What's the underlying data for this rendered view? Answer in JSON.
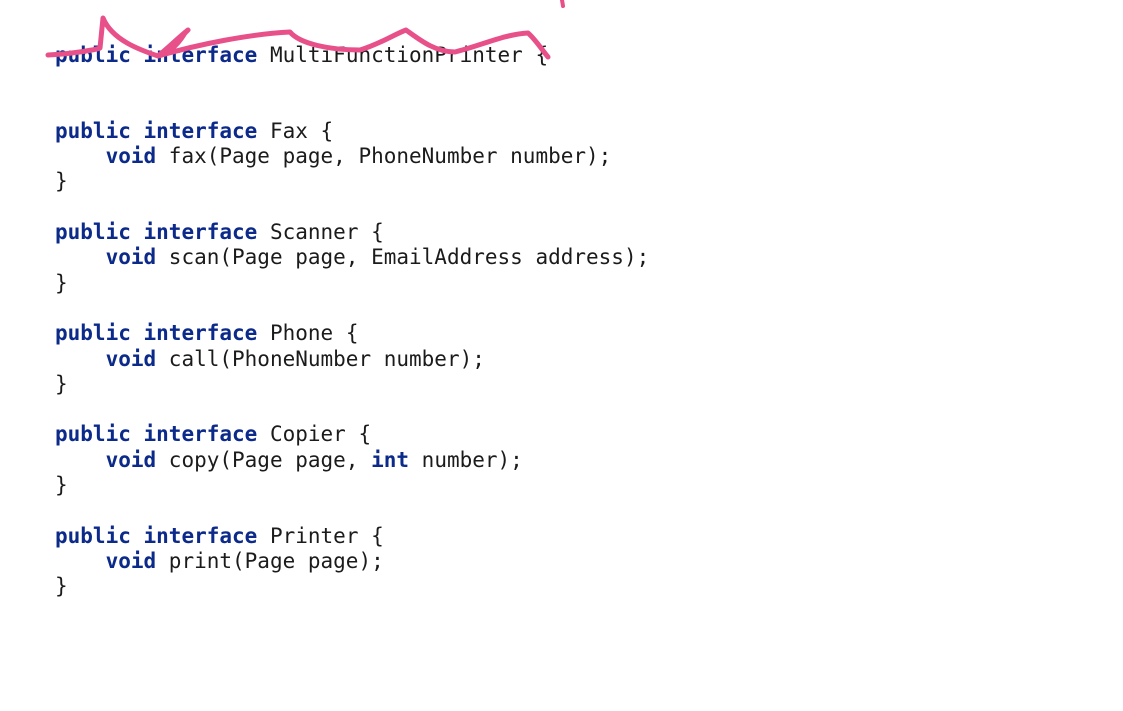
{
  "theme": {
    "keyword_color": "#0b2a8a",
    "text_color": "#1b1b1b",
    "annotation_color": "#e8508a"
  },
  "code": {
    "lines": [
      [
        {
          "k": true,
          "t": "public"
        },
        {
          "t": " "
        },
        {
          "k": true,
          "t": "interface"
        },
        {
          "t": " MultiFunctionPrinter {"
        }
      ],
      [],
      [],
      [
        {
          "k": true,
          "t": "public"
        },
        {
          "t": " "
        },
        {
          "k": true,
          "t": "interface"
        },
        {
          "t": " Fax {"
        }
      ],
      [
        {
          "t": "    "
        },
        {
          "k": true,
          "t": "void"
        },
        {
          "t": " fax(Page page, PhoneNumber number);"
        }
      ],
      [
        {
          "t": "}"
        }
      ],
      [],
      [
        {
          "k": true,
          "t": "public"
        },
        {
          "t": " "
        },
        {
          "k": true,
          "t": "interface"
        },
        {
          "t": " Scanner {"
        }
      ],
      [
        {
          "t": "    "
        },
        {
          "k": true,
          "t": "void"
        },
        {
          "t": " scan(Page page, EmailAddress address);"
        }
      ],
      [
        {
          "t": "}"
        }
      ],
      [],
      [
        {
          "k": true,
          "t": "public"
        },
        {
          "t": " "
        },
        {
          "k": true,
          "t": "interface"
        },
        {
          "t": " Phone {"
        }
      ],
      [
        {
          "t": "    "
        },
        {
          "k": true,
          "t": "void"
        },
        {
          "t": " call(PhoneNumber number);"
        }
      ],
      [
        {
          "t": "}"
        }
      ],
      [],
      [
        {
          "k": true,
          "t": "public"
        },
        {
          "t": " "
        },
        {
          "k": true,
          "t": "interface"
        },
        {
          "t": " Copier {"
        }
      ],
      [
        {
          "t": "    "
        },
        {
          "k": true,
          "t": "void"
        },
        {
          "t": " copy(Page page, "
        },
        {
          "k": true,
          "t": "int"
        },
        {
          "t": " number);"
        }
      ],
      [
        {
          "t": "}"
        }
      ],
      [],
      [
        {
          "k": true,
          "t": "public"
        },
        {
          "t": " "
        },
        {
          "k": true,
          "t": "interface"
        },
        {
          "t": " Printer {"
        }
      ],
      [
        {
          "t": "    "
        },
        {
          "k": true,
          "t": "void"
        },
        {
          "t": " print(Page page);"
        }
      ],
      [
        {
          "t": "}"
        }
      ]
    ]
  }
}
